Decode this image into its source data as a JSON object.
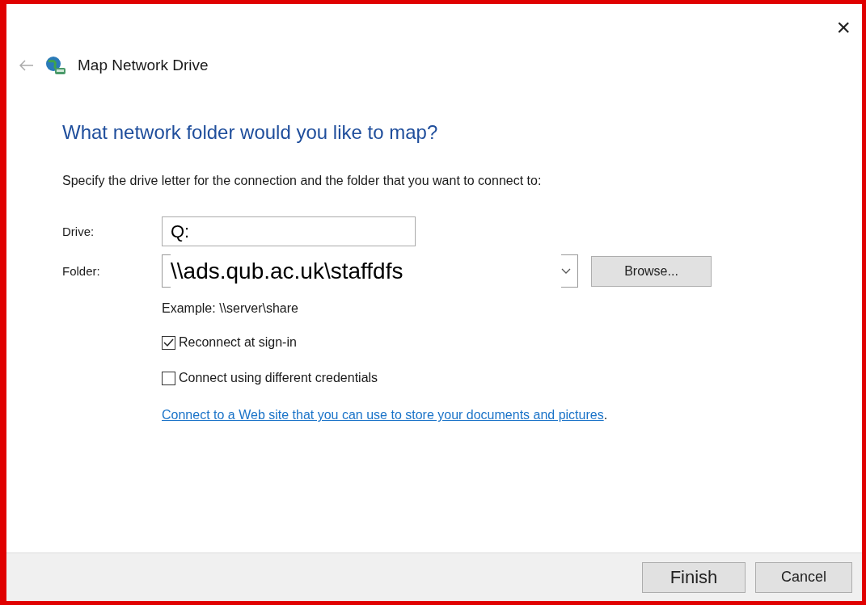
{
  "window": {
    "title": "Map Network Drive",
    "close": "×"
  },
  "heading": "What network folder would you like to map?",
  "instructions": "Specify the drive letter for the connection and the folder that you want to connect to:",
  "drive": {
    "label": "Drive:",
    "value": "Q:"
  },
  "folder": {
    "label": "Folder:",
    "value": "\\\\ads.qub.ac.uk\\staffdfs",
    "button": "Browse..."
  },
  "example": "Example: \\\\server\\share",
  "options": [
    {
      "label": "Reconnect at sign-in",
      "checked": true
    },
    {
      "label": "Connect using different credentials",
      "checked": false
    }
  ],
  "link": "Connect to a Web site that you can use to store your documents and pictures",
  "link_tail": ".",
  "buttons": [
    "Finish",
    "Cancel"
  ]
}
